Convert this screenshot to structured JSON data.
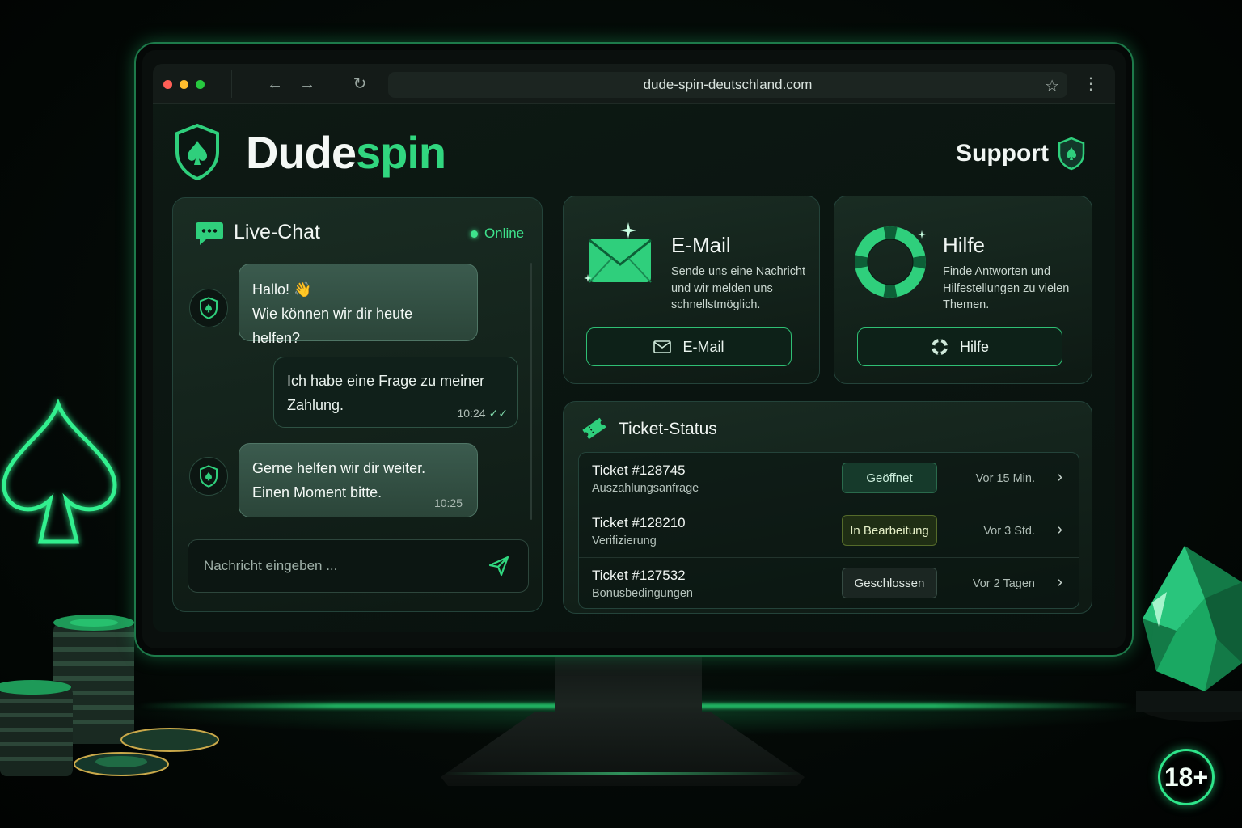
{
  "browser": {
    "url": "dude-spin-deutschland.com"
  },
  "header": {
    "brand_part1": "Dude",
    "brand_part2": "spin",
    "support_label": "Support"
  },
  "chat": {
    "title": "Live-Chat",
    "status": "Online",
    "messages": [
      {
        "from": "agent",
        "line1": "Hallo! 👋",
        "line2": "Wie können wir dir heute helfen?"
      },
      {
        "from": "user",
        "line1": "Ich habe eine Frage zu meiner",
        "line2": "Zahlung.",
        "time": "10:24"
      },
      {
        "from": "agent",
        "line1": "Gerne helfen wir dir weiter.",
        "line2": "Einen Moment bitte.",
        "time": "10:25"
      }
    ],
    "input_placeholder": "Nachricht eingeben ..."
  },
  "email_card": {
    "title": "E-Mail",
    "description": "Sende uns eine Nachricht und wir melden uns schnellstmöglich.",
    "button_label": "E-Mail"
  },
  "help_card": {
    "title": "Hilfe",
    "description": "Finde Antworten und Hilfestellungen zu vielen Themen.",
    "button_label": "Hilfe"
  },
  "tickets": {
    "title": "Ticket-Status",
    "rows": [
      {
        "id": "Ticket #128745",
        "subject": "Auszahlungsanfrage",
        "status": "Geöffnet",
        "time": "Vor 15 Min."
      },
      {
        "id": "Ticket #128210",
        "subject": "Verifizierung",
        "status": "In Bearbeitung",
        "time": "Vor 3 Std."
      },
      {
        "id": "Ticket #127532",
        "subject": "Bonusbedingungen",
        "status": "Geschlossen",
        "time": "Vor 2 Tagen"
      }
    ]
  },
  "age_badge": "18+",
  "colors": {
    "accent": "#31d67f",
    "background": "#040a07",
    "card": "#14241c"
  }
}
